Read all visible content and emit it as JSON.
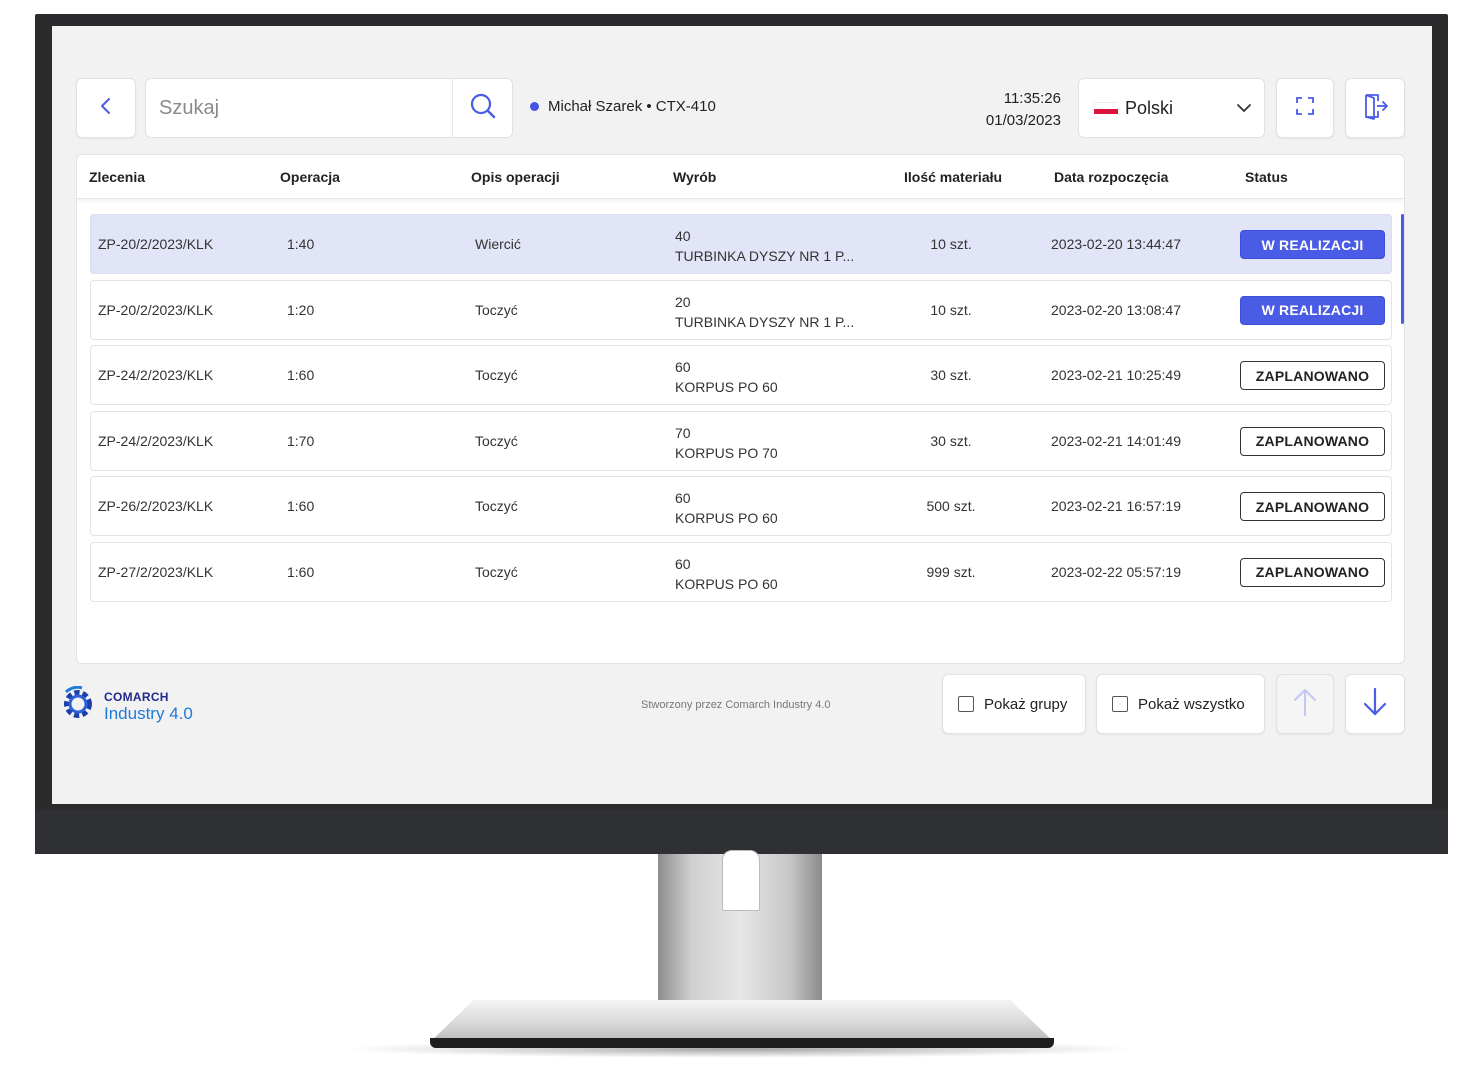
{
  "search": {
    "placeholder": "Szukaj"
  },
  "user": {
    "label": "Michał Szarek • CTX-410"
  },
  "clock": {
    "time": "11:35:26",
    "date": "01/03/2023"
  },
  "language": {
    "selected": "Polski",
    "flag_colors": [
      "#ffffff",
      "#dc143c"
    ]
  },
  "table": {
    "headers": [
      "Zlecenia",
      "Operacja",
      "Opis operacji",
      "Wyrób",
      "Ilość materiału",
      "Data rozpoczęcia",
      "Status"
    ],
    "rows": [
      {
        "order": "ZP-20/2/2023/KLK",
        "operation": "1:40",
        "description": "Wiercić",
        "product_code": "40",
        "product_name": "TURBINKA DYSZY NR 1 P...",
        "quantity": "10 szt.",
        "start": "2023-02-20 13:44:47",
        "status": "W REALIZACJI"
      },
      {
        "order": "ZP-20/2/2023/KLK",
        "operation": "1:20",
        "description": "Toczyć",
        "product_code": "20",
        "product_name": "TURBINKA DYSZY NR 1 P...",
        "quantity": "10 szt.",
        "start": "2023-02-20 13:08:47",
        "status": "W REALIZACJI"
      },
      {
        "order": "ZP-24/2/2023/KLK",
        "operation": "1:60",
        "description": "Toczyć",
        "product_code": "60",
        "product_name": "KORPUS PO 60",
        "quantity": "30 szt.",
        "start": "2023-02-21 10:25:49",
        "status": "ZAPLANOWANO"
      },
      {
        "order": "ZP-24/2/2023/KLK",
        "operation": "1:70",
        "description": "Toczyć",
        "product_code": "70",
        "product_name": "KORPUS PO 70",
        "quantity": "30 szt.",
        "start": "2023-02-21 14:01:49",
        "status": "ZAPLANOWANO"
      },
      {
        "order": "ZP-26/2/2023/KLK",
        "operation": "1:60",
        "description": "Toczyć",
        "product_code": "60",
        "product_name": "KORPUS PO 60",
        "quantity": "500 szt.",
        "start": "2023-02-21 16:57:19",
        "status": "ZAPLANOWANO"
      },
      {
        "order": "ZP-27/2/2023/KLK",
        "operation": "1:60",
        "description": "Toczyć",
        "product_code": "60",
        "product_name": "KORPUS PO 60",
        "quantity": "999 szt.",
        "start": "2023-02-22 05:57:19",
        "status": "ZAPLANOWANO"
      }
    ]
  },
  "footer": {
    "logo_top": "COMARCH",
    "logo_bottom": "Industry 4.0",
    "credit": "Stworzony przez Comarch Industry 4.0",
    "show_groups": "Pokaż grupy",
    "show_all": "Pokaż wszystko"
  },
  "colors": {
    "accent": "#4a5be6",
    "active_row": "#e2e4f7",
    "brand_blue": "#1f7ad9"
  }
}
